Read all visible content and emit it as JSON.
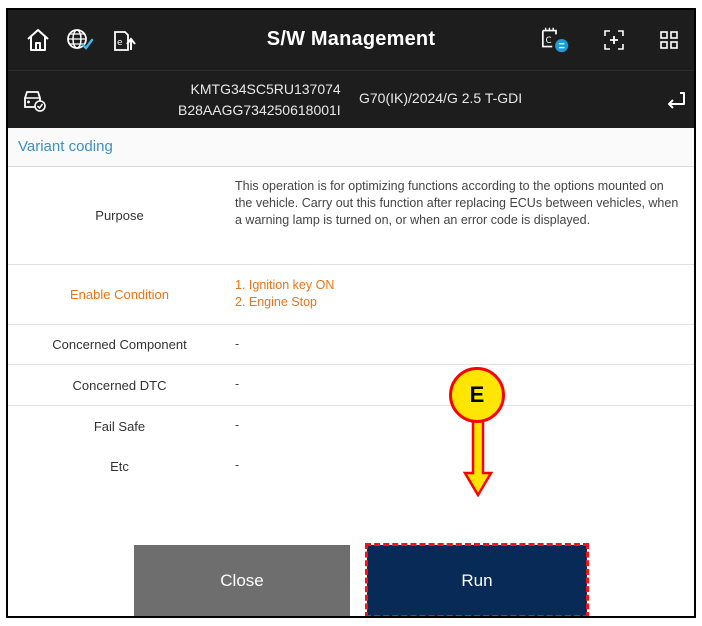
{
  "header": {
    "title": "S/W Management",
    "icons": {
      "home": "home-icon",
      "globe": "globe-check-icon",
      "ecu_upload": "ecu-upload-icon",
      "ecu_status": "ecu-status-icon",
      "capture": "capture-icon",
      "grid": "grid-menu-icon"
    }
  },
  "vehicle": {
    "vin": "KMTG34SC5RU137074",
    "code": "B28AAGG734250618001I",
    "model": "G70(IK)/2024/G 2.5 T-GDI",
    "icons": {
      "vehicle": "vehicle-check-icon",
      "back": "back-icon"
    }
  },
  "section": {
    "title": "Variant coding"
  },
  "rows": [
    {
      "label": "Purpose",
      "value": "This operation is for optimizing functions according to the options mounted on the vehicle. Carry out this function after replacing ECUs between vehicles, when a warning lamp is turned on, or when an error code is displayed."
    },
    {
      "label": "Enable Condition",
      "value_lines": [
        "1. Ignition key ON",
        "2. Engine Stop"
      ]
    },
    {
      "label": "Concerned Component",
      "value": "-"
    },
    {
      "label": "Concerned DTC",
      "value": "-"
    },
    {
      "label": "Fail Safe",
      "value": "-"
    },
    {
      "label": "Etc",
      "value": "-"
    }
  ],
  "buttons": {
    "close": "Close",
    "run": "Run"
  },
  "annotation": {
    "label": "E"
  },
  "colors": {
    "header_bg": "#1d1d1d",
    "accent_blue": "#3f8fc4",
    "enable_orange": "#e8751a",
    "close_btn": "#6e6e6e",
    "run_btn": "#072a56",
    "callout_fill": "#ffe600",
    "callout_red": "#ff0000"
  }
}
